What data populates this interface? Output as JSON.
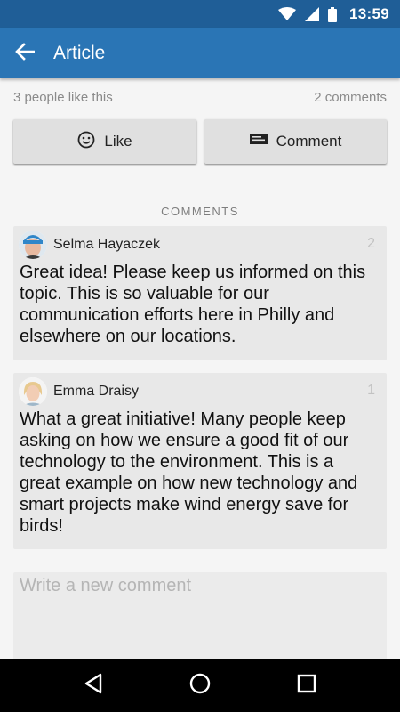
{
  "status_bar": {
    "time": "13:59",
    "icons": [
      "wifi-icon",
      "signal-icon",
      "battery-icon"
    ]
  },
  "app_bar": {
    "title": "Article",
    "back_icon": "arrow-left-icon"
  },
  "stats": {
    "likes_text": "3 people like this",
    "comments_text": "2 comments"
  },
  "actions": {
    "like_label": "Like",
    "like_icon": "smiley-icon",
    "comment_label": "Comment",
    "comment_icon": "comment-card-icon"
  },
  "comments_section": {
    "header": "COMMENTS",
    "items": [
      {
        "author": "Selma Hayaczek",
        "likes": "2",
        "text": "Great idea! Please keep us informed on this topic. This is so valuable for our communication efforts here in Philly and elsewhere on our locations."
      },
      {
        "author": "Emma Draisy",
        "likes": "1",
        "text": "What a great initiative! Many people keep asking on how we ensure a good fit of our technology to the environment. This is a great example on how new technology and smart projects make wind energy save for birds!"
      }
    ]
  },
  "new_comment": {
    "placeholder": "Write a new comment",
    "value": ""
  },
  "nav_bar": {
    "icons": [
      "back-triangle-icon",
      "home-circle-icon",
      "recents-square-icon"
    ]
  },
  "colors": {
    "status_bar": "#1f5e97",
    "app_bar": "#2a75b5",
    "background": "#f5f5f5",
    "card": "#e8e8e8",
    "button": "#e0e0e0"
  }
}
